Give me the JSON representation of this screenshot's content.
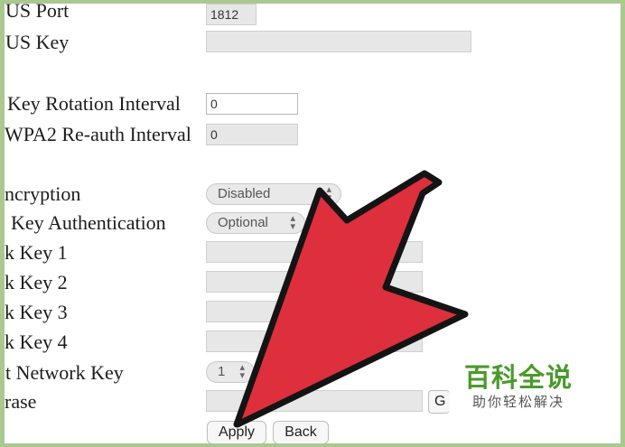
{
  "labels": {
    "radius_port": "US Port",
    "radius_key": "US Key",
    "key_rotation": "Key Rotation Interval",
    "wpa2_reauth": "WPA2 Re-auth Interval",
    "encryption": "ncryption",
    "key_auth": "Key Authentication",
    "network_key_1": "k Key 1",
    "network_key_2": "k Key 2",
    "network_key_3": "k Key 3",
    "network_key_4": "k Key 4",
    "current_network_key": "t Network Key",
    "passphrase": "rase"
  },
  "values": {
    "radius_port": "1812",
    "radius_key": "",
    "key_rotation": "0",
    "wpa2_reauth": "0",
    "encryption": "Disabled",
    "key_auth": "Optional",
    "network_key_1": "",
    "network_key_2": "",
    "network_key_3": "",
    "network_key_4": "",
    "current_network_key": "1",
    "passphrase": "",
    "generate_label": "G"
  },
  "buttons": {
    "apply": "Apply",
    "back": "Back"
  },
  "watermark": {
    "main": "百科全说",
    "sub": "助你轻松解决"
  },
  "colors": {
    "arrow_fill": "#dd2f3c",
    "arrow_stroke": "#141414",
    "frame": "#a9c98e",
    "watermark_green": "#4a9a2a"
  }
}
